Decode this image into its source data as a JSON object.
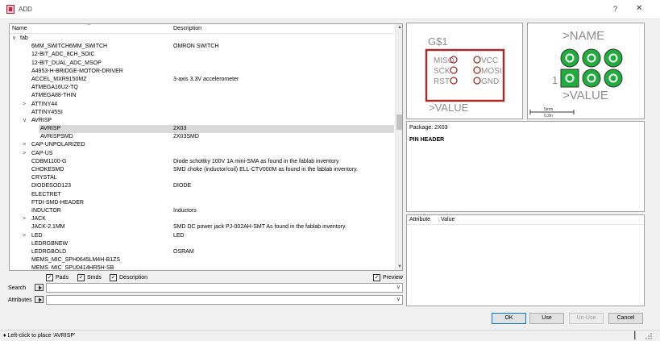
{
  "window": {
    "title": "ADD",
    "help_label": "?",
    "close_label": "✕"
  },
  "tree": {
    "col_name": "Name",
    "col_desc": "Description",
    "rows": [
      {
        "level": 0,
        "expander": "∨",
        "name": "fab",
        "desc": ""
      },
      {
        "level": 1,
        "expander": "",
        "name": "6MM_SWITCH6MM_SWITCH",
        "desc": "OMRON SWITCH"
      },
      {
        "level": 1,
        "expander": "",
        "name": "12-BIT_ADC_8CH_SOIC",
        "desc": ""
      },
      {
        "level": 1,
        "expander": "",
        "name": "12-BIT_DUAL_ADC_MSOP",
        "desc": ""
      },
      {
        "level": 1,
        "expander": "",
        "name": "A4953-H-BRIDGE-MOTOR-DRIVER",
        "desc": ""
      },
      {
        "level": 1,
        "expander": "",
        "name": "ACCEL_MXR9150MZ",
        "desc": "3-axis 3.3V accelerometer"
      },
      {
        "level": 1,
        "expander": "",
        "name": "ATMEGA16U2-TQ",
        "desc": ""
      },
      {
        "level": 1,
        "expander": "",
        "name": "ATMEGA88-THIN",
        "desc": ""
      },
      {
        "level": 1,
        "expander": ">",
        "name": "ATTINY44",
        "desc": ""
      },
      {
        "level": 1,
        "expander": "",
        "name": "ATTINY45SI",
        "desc": ""
      },
      {
        "level": 1,
        "expander": "∨",
        "name": "AVRISP",
        "desc": ""
      },
      {
        "level": 2,
        "expander": "",
        "name": "AVRISP",
        "desc": "2X03",
        "selected": true
      },
      {
        "level": 2,
        "expander": "",
        "name": "AVRISPSMD",
        "desc": "2X03SMD"
      },
      {
        "level": 1,
        "expander": ">",
        "name": "CAP-UNPOLARIZED",
        "desc": ""
      },
      {
        "level": 1,
        "expander": ">",
        "name": "CAP-US",
        "desc": ""
      },
      {
        "level": 1,
        "expander": "",
        "name": "CDBM1100-G",
        "desc": "Diode schottky 100V 1A mini-SMA as found in the fablab inventory"
      },
      {
        "level": 1,
        "expander": "",
        "name": "CHOKESMD",
        "desc": "SMD choke (inductor/coil) ELL-CTV000M as found in the fablab inventory."
      },
      {
        "level": 1,
        "expander": "",
        "name": "CRYSTAL",
        "desc": ""
      },
      {
        "level": 1,
        "expander": "",
        "name": "DIODESOD123",
        "desc": "DIODE"
      },
      {
        "level": 1,
        "expander": "",
        "name": "ELECTRET",
        "desc": ""
      },
      {
        "level": 1,
        "expander": "",
        "name": "FTDI-SMD-HEADER",
        "desc": ""
      },
      {
        "level": 1,
        "expander": "",
        "name": "INDUCTOR",
        "desc": "Inductors"
      },
      {
        "level": 1,
        "expander": ">",
        "name": "JACK",
        "desc": ""
      },
      {
        "level": 1,
        "expander": "",
        "name": "JACK-2.1MM",
        "desc": "SMD DC power jack PJ-002AH-SMT As found in the fablab inventory."
      },
      {
        "level": 1,
        "expander": ">",
        "name": "LED",
        "desc": "LED"
      },
      {
        "level": 1,
        "expander": "",
        "name": "LEDRGBNEW",
        "desc": ""
      },
      {
        "level": 1,
        "expander": "",
        "name": "LEDRGBOLD",
        "desc": "OSRAM"
      },
      {
        "level": 1,
        "expander": "",
        "name": "MEMS_MIC_SPH0645LM4H-B1ZS",
        "desc": ""
      },
      {
        "level": 1,
        "expander": "",
        "name": "MEMS_MIC_SPU0414HR5H-SB",
        "desc": ""
      }
    ]
  },
  "filters": {
    "pads_label": "Pads",
    "pads_checked": true,
    "smds_label": "Smds",
    "smds_checked": true,
    "description_label": "Description",
    "description_checked": true,
    "preview_label": "Preview",
    "preview_checked": true,
    "check_mark": "✓"
  },
  "search": {
    "label": "Search",
    "value": ""
  },
  "attributes_filter": {
    "label": "Attributes",
    "value": ""
  },
  "symbol_preview": {
    "name": "G$1",
    "value": ">VALUE",
    "pins_left": [
      "MISO",
      "SCK",
      "RST"
    ],
    "pins_right": [
      "VCC",
      "MOSI",
      "GND"
    ]
  },
  "package_preview": {
    "name": ">NAME",
    "value": ">VALUE",
    "pin1": "1",
    "scale_top": "5mm",
    "scale_bottom": "0.2in"
  },
  "info": {
    "package_line": "Package: 2X03",
    "title": "PIN HEADER"
  },
  "attributes_table": {
    "col_attribute": "Attribute",
    "col_value": "Value"
  },
  "buttons": {
    "ok": "OK",
    "use": "Use",
    "unuse": "Un-Use",
    "cancel": "Cancel"
  },
  "status": {
    "text": "♦ Left-click to place 'AVRISP'"
  },
  "colors": {
    "symbol_red": "#a52a2a",
    "symbol_gray": "#8c8c8c",
    "pad_green": "#1fae3c"
  }
}
